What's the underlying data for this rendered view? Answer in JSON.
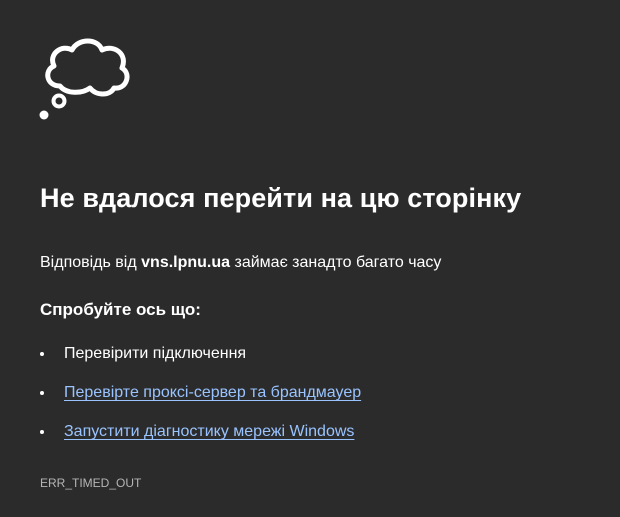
{
  "error_page": {
    "icon": "thought-cloud-icon",
    "title": "Не вдалося перейти на цю сторінку",
    "message": {
      "prefix": "Відповідь від ",
      "host": "vns.lpnu.ua",
      "suffix": " займає занадто багато часу"
    },
    "suggestions_heading": "Спробуйте ось що:",
    "suggestions": [
      {
        "text": "Перевірити підключення",
        "is_link": false
      },
      {
        "text": "Перевірте проксі-сервер та брандмауер",
        "is_link": true
      },
      {
        "text": "Запустити діагностику мережі Windows",
        "is_link": true
      }
    ],
    "error_code": "ERR_TIMED_OUT"
  },
  "colors": {
    "background": "#2b2b2b",
    "text": "#ffffff",
    "link": "#99c3ff",
    "muted": "#b5b5b5"
  }
}
